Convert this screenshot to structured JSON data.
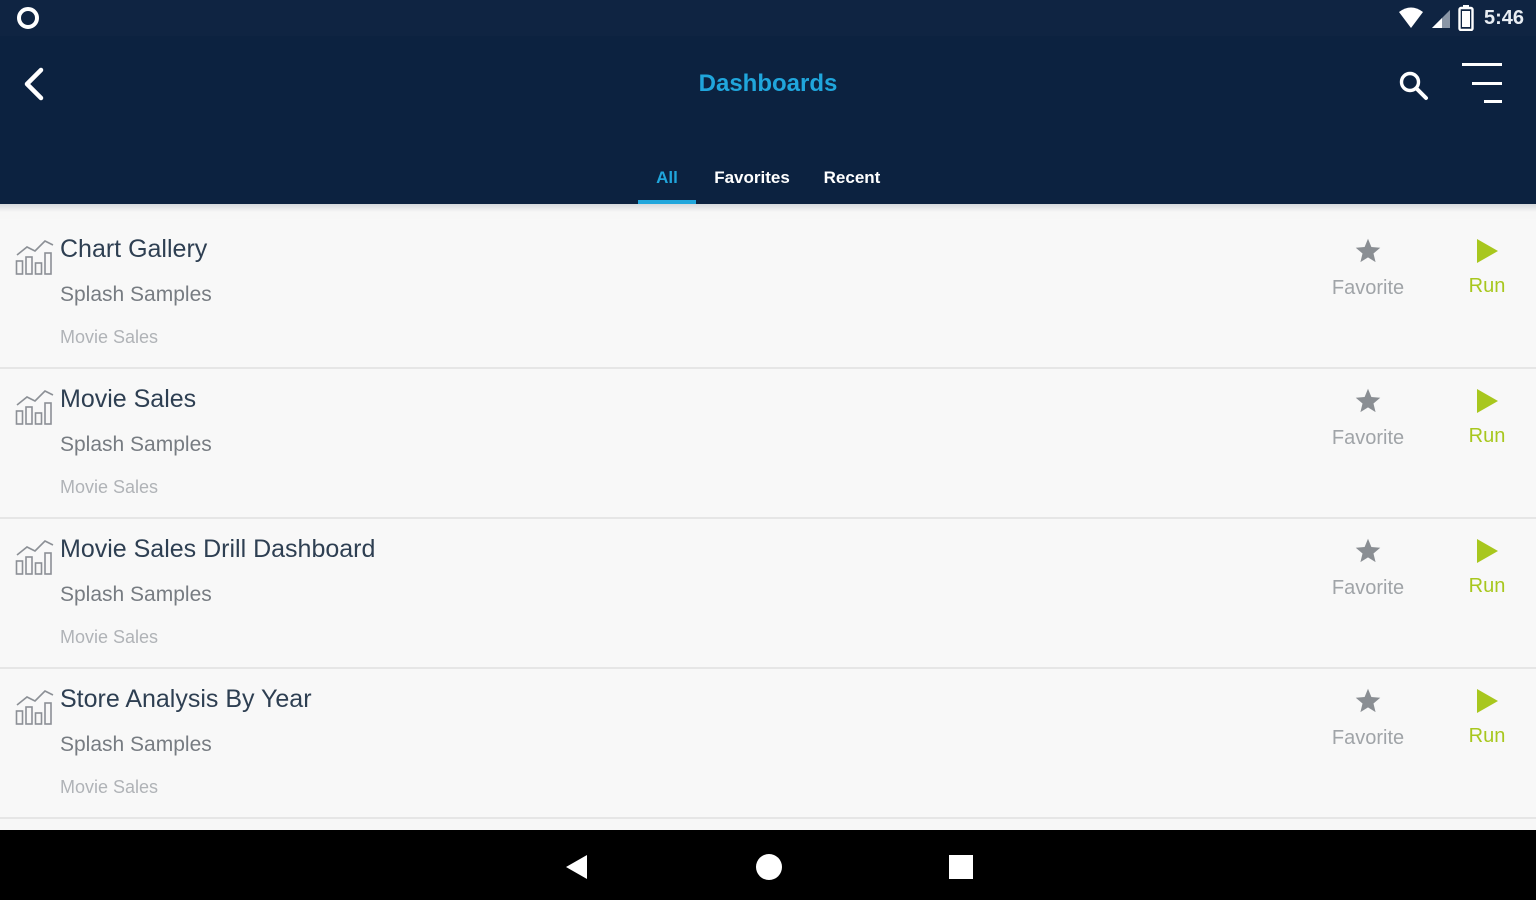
{
  "status_bar": {
    "time": "5:46"
  },
  "header": {
    "title": "Dashboards"
  },
  "tabs": [
    {
      "label": "All",
      "active": true
    },
    {
      "label": "Favorites",
      "active": false
    },
    {
      "label": "Recent",
      "active": false
    }
  ],
  "dashboards": [
    {
      "title": "Chart Gallery",
      "subtitle": "Splash Samples",
      "category": "Movie Sales",
      "favorite_label": "Favorite",
      "run_label": "Run"
    },
    {
      "title": "Movie Sales",
      "subtitle": "Splash Samples",
      "category": "Movie Sales",
      "favorite_label": "Favorite",
      "run_label": "Run"
    },
    {
      "title": "Movie Sales Drill Dashboard",
      "subtitle": "Splash Samples",
      "category": "Movie Sales",
      "favorite_label": "Favorite",
      "run_label": "Run"
    },
    {
      "title": "Store Analysis By Year",
      "subtitle": "Splash Samples",
      "category": "Movie Sales",
      "favorite_label": "Favorite",
      "run_label": "Run"
    }
  ],
  "colors": {
    "app_bar": "#0c2240",
    "accent": "#20a6dc",
    "run": "#a8c71e",
    "star": "#8a8e93"
  },
  "icons": {
    "status_left": "circle-notification-icon",
    "wifi": "wifi-icon",
    "signal": "signal-icon",
    "battery": "battery-icon",
    "back": "arrow-back-icon",
    "search": "search-icon",
    "menu": "sort-menu-icon",
    "row": "dashboard-chart-icon",
    "favorite": "star-icon",
    "run": "play-icon",
    "nav_back": "nav-back-triangle-icon",
    "nav_home": "nav-home-circle-icon",
    "nav_recent": "nav-recents-square-icon"
  }
}
